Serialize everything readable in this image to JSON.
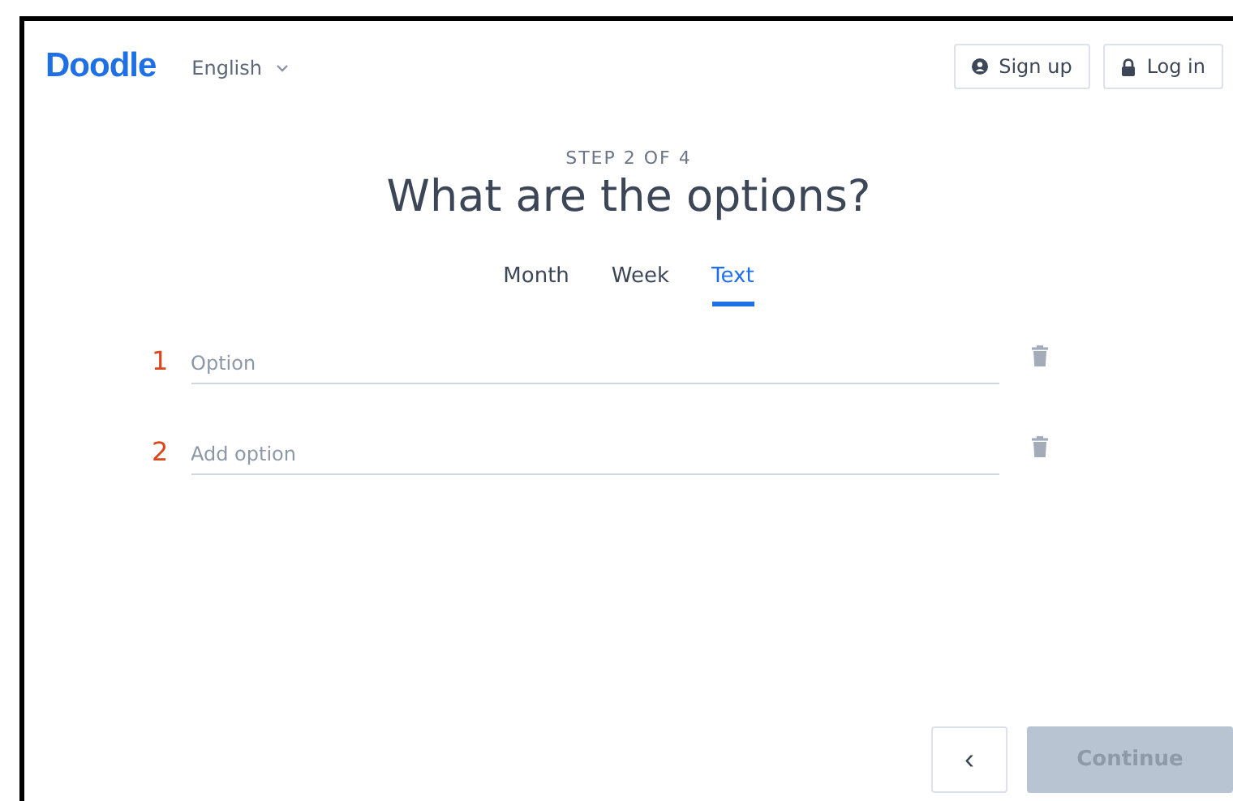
{
  "header": {
    "logo": "Doodle",
    "language": "English",
    "buttons": [
      {
        "label": "Sign up",
        "kind": "signup"
      },
      {
        "label": "Log in",
        "kind": "login"
      }
    ]
  },
  "step": "STEP 2 OF 4",
  "title": "What are the options?",
  "tabs": [
    {
      "label": "Month",
      "selected": false
    },
    {
      "label": "Week",
      "selected": false
    },
    {
      "label": "Text",
      "selected": true
    }
  ],
  "options": [
    {
      "number": "1",
      "placeholder": "Option"
    },
    {
      "number": "2",
      "placeholder": "Add option"
    }
  ],
  "footer": {
    "back": "‹",
    "continue": {
      "label": "Continue",
      "disabled": true
    }
  }
}
